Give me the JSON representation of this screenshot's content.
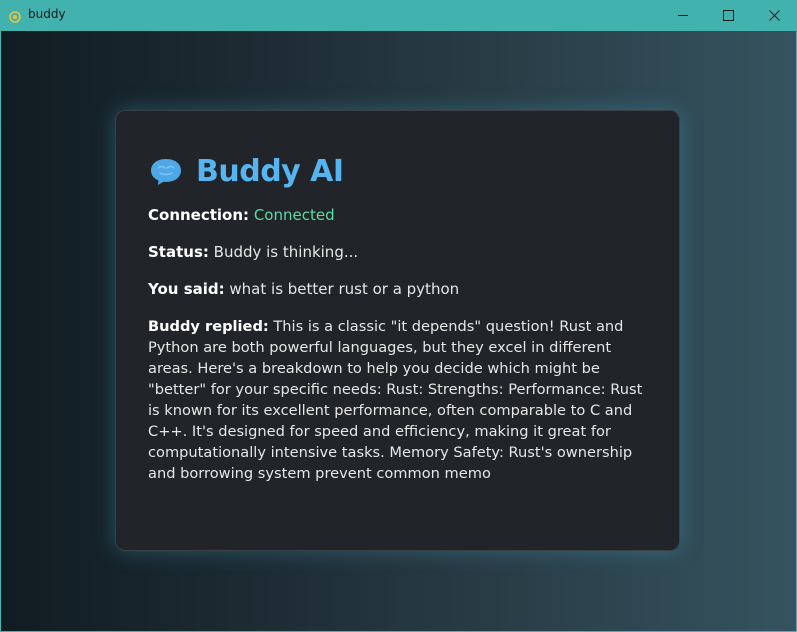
{
  "window": {
    "title": "buddy",
    "icons": {
      "app": "app-logo-icon",
      "minimize": "minimize-icon",
      "maximize": "maximize-icon",
      "close": "close-icon"
    }
  },
  "card": {
    "icon": "speech-bubble-icon",
    "title": "Buddy AI",
    "connection_label": "Connection:",
    "connection_value": "Connected",
    "status_label": "Status:",
    "status_value": "Buddy is thinking...",
    "said_label": "You said:",
    "said_value": "what is better rust or a python",
    "reply_label": "Buddy replied:",
    "reply_value": "This is a classic \"it depends\" question! Rust and Python are both powerful languages, but they excel in different areas. Here's a breakdown to help you decide which might be \"better\" for your specific needs: Rust: Strengths: Performance: Rust is known for its excellent performance, often comparable to C and C++. It's designed for speed and efficiency, making it great for computationally intensive tasks. Memory Safety: Rust's ownership and borrowing system prevent common memo"
  },
  "colors": {
    "titlebar": "#41b2ae",
    "accent": "#56b4f0",
    "connected": "#5ddba6",
    "card": "#212428"
  }
}
